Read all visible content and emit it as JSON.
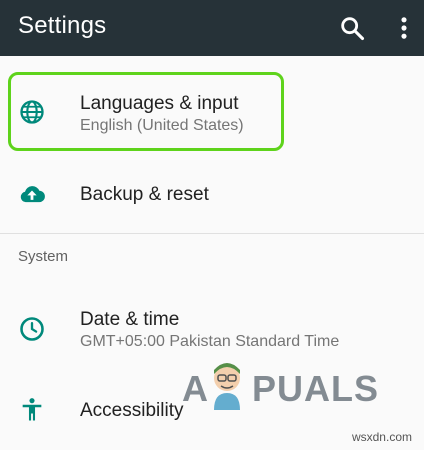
{
  "appbar": {
    "title": "Settings",
    "search_icon": "search-icon",
    "more_icon": "more-vert-icon"
  },
  "items": [
    {
      "label": "Languages & input",
      "sub": "English (United States)",
      "icon": "globe-icon"
    },
    {
      "label": "Backup & reset",
      "icon": "cloud-upload-icon"
    },
    {
      "label": "Date & time",
      "sub": "GMT+05:00 Pakistan Standard Time",
      "icon": "clock-icon"
    },
    {
      "label": "Accessibility",
      "icon": "accessibility-icon"
    }
  ],
  "section_header": "System",
  "watermark": {
    "left": "A",
    "right": "PUALS"
  },
  "site": "wsxdn.com",
  "colors": {
    "appbar": "#263238",
    "icon_teal": "#00897b",
    "highlight_green": "#5ed31b"
  }
}
